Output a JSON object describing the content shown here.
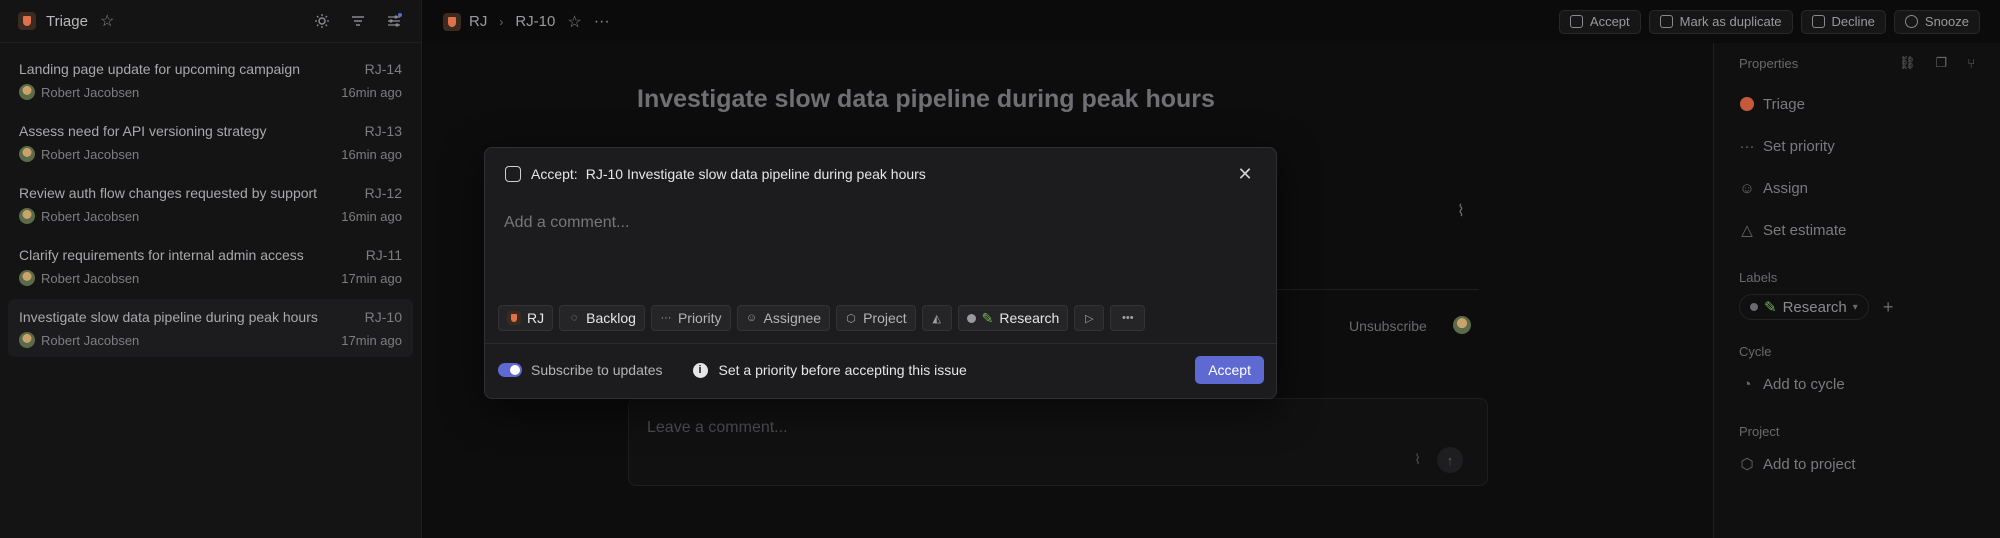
{
  "left": {
    "title": "Triage",
    "issues": [
      {
        "title": "Landing page update for upcoming campaign",
        "id": "RJ-14",
        "author": "Robert Jacobsen",
        "time": "16min ago"
      },
      {
        "title": "Assess need for API versioning strategy",
        "id": "RJ-13",
        "author": "Robert Jacobsen",
        "time": "16min ago"
      },
      {
        "title": "Review auth flow changes requested by support",
        "id": "RJ-12",
        "author": "Robert Jacobsen",
        "time": "16min ago"
      },
      {
        "title": "Clarify requirements for internal admin access",
        "id": "RJ-11",
        "author": "Robert Jacobsen",
        "time": "17min ago"
      },
      {
        "title": "Investigate slow data pipeline during peak hours",
        "id": "RJ-10",
        "author": "Robert Jacobsen",
        "time": "17min ago"
      }
    ]
  },
  "topbar": {
    "team": "RJ",
    "issue_id": "RJ-10",
    "accept": "Accept",
    "duplicate": "Mark as duplicate",
    "decline": "Decline",
    "snooze": "Snooze"
  },
  "main": {
    "title": "Investigate slow data pipeline during peak hours",
    "unsubscribe": "Unsubscribe",
    "comment_placeholder": "Leave a comment..."
  },
  "properties": {
    "heading": "Properties",
    "status": "Triage",
    "priority": "Set priority",
    "assign": "Assign",
    "estimate": "Set estimate",
    "labels_heading": "Labels",
    "label": "Research",
    "cycle_heading": "Cycle",
    "cycle": "Add to cycle",
    "project_heading": "Project",
    "project": "Add to project"
  },
  "modal": {
    "label": "Accept:",
    "issue": "RJ-10 Investigate slow data pipeline during peak hours",
    "placeholder": "Add a comment...",
    "chips": {
      "team": "RJ",
      "status": "Backlog",
      "priority": "Priority",
      "assignee": "Assignee",
      "project": "Project",
      "label": "Research"
    },
    "subscribe": "Subscribe to updates",
    "warning": "Set a priority before accepting this issue",
    "accept_button": "Accept"
  },
  "colors": {
    "accent": "#5e6ad2",
    "triage": "#c55a3b",
    "label_pen": "#6fb35a"
  }
}
